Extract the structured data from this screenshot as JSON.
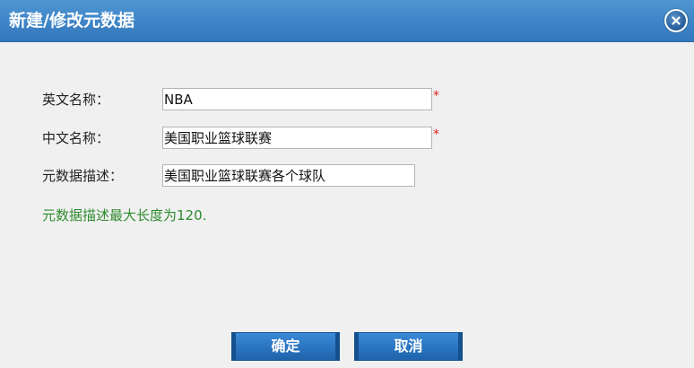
{
  "dialog": {
    "title": "新建/修改元数据",
    "close_icon": "close-icon"
  },
  "form": {
    "english_name": {
      "label": "英文名称：",
      "value": "NBA",
      "required_mark": "*"
    },
    "chinese_name": {
      "label": "中文名称：",
      "value": "美国职业篮球联赛",
      "required_mark": "*"
    },
    "description": {
      "label": "元数据描述：",
      "value": "美国职业篮球联赛各个球队"
    },
    "hint": "元数据描述最大长度为120."
  },
  "buttons": {
    "confirm_label": "确定",
    "cancel_label": "取消"
  },
  "colors": {
    "titlebar": "#3f86c8",
    "required": "#e02020",
    "hint": "#2e8b2e",
    "button": "#2a74c0"
  }
}
